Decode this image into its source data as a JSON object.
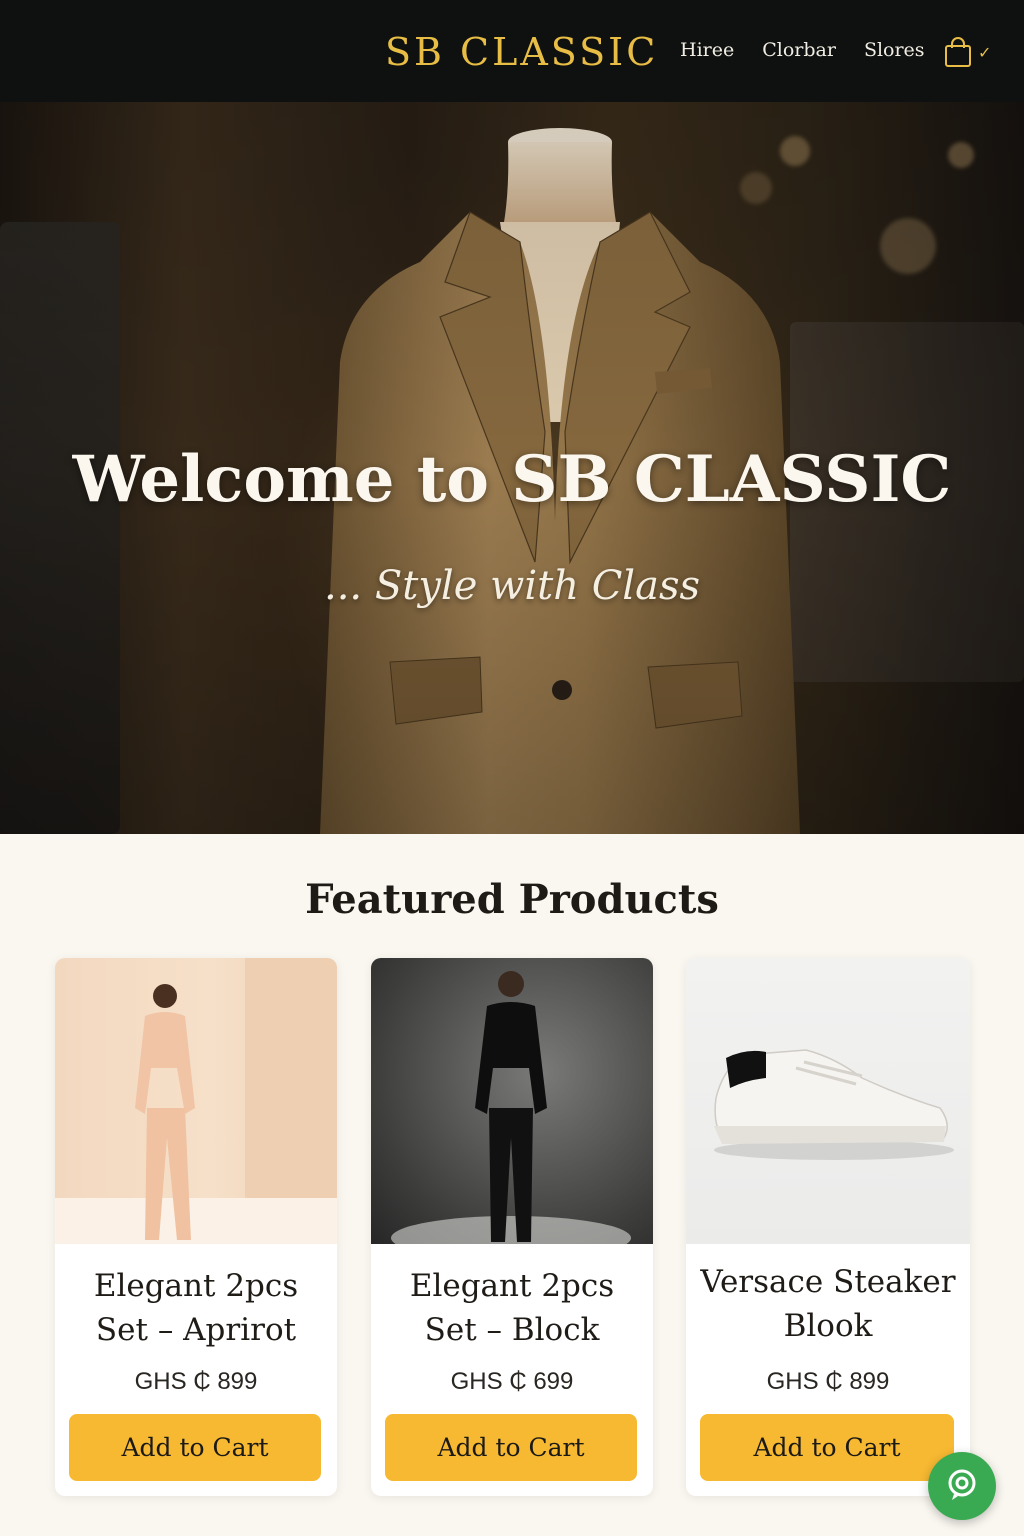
{
  "header": {
    "brand": "SB CLASSIC",
    "nav": [
      "Hiree",
      "Clorbar",
      "Slores"
    ],
    "cart_icon": "shopping-bag-icon",
    "cart_indicator": "✓",
    "accent_color": "#e8bd46",
    "background_color": "#0f1110"
  },
  "hero": {
    "title": "Welcome to SB CLASSIC",
    "subtitle": "... Style with Class",
    "image": "mannequin-blazer-photo"
  },
  "featured": {
    "title": "Featured Products",
    "products": [
      {
        "name_line1": "Elegant 2pcs",
        "name_line2": "Set – Aprirot",
        "price": "GHS ₵ 899",
        "button": "Add to Cart",
        "image": "man-apricot-set-photo"
      },
      {
        "name_line1": "Elegant 2pcs",
        "name_line2": "Set – Block",
        "price": "GHS ₵ 699",
        "button": "Add to Cart",
        "image": "man-black-set-photo"
      },
      {
        "name_line1": "Versace Steaker",
        "name_line2": "Blook",
        "price": "GHS ₵ 899",
        "button": "Add to Cart",
        "image": "white-sneaker-photo"
      }
    ],
    "button_color": "#f7b932"
  },
  "chat": {
    "icon": "chat-support-icon",
    "color": "#3aaa52"
  }
}
